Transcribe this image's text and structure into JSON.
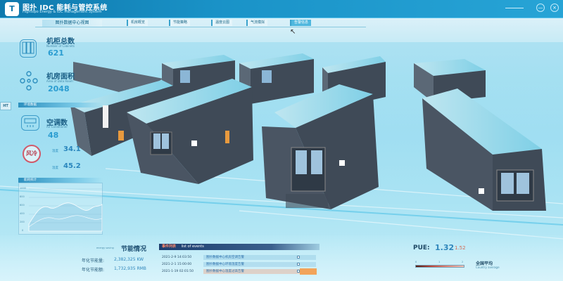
{
  "header": {
    "logo_glyph": "T",
    "title": "图扑 IDC 能耗与管控系统",
    "subtitle": "Hightopo Energy & IDC Management System",
    "controls": [
      "—",
      "×"
    ]
  },
  "nav": {
    "active_label": "图扑数据中心视图",
    "tabs": [
      {
        "label": "机房概览",
        "selected": false
      },
      {
        "label": "节能策略",
        "selected": false
      },
      {
        "label": "温度云图",
        "selected": false
      },
      {
        "label": "气流模拟",
        "selected": false
      },
      {
        "label": "告警信息",
        "selected": true
      }
    ]
  },
  "kpis": {
    "cabinets": {
      "label": "机柜总数",
      "sub": "Number of Cabinets",
      "value": "621",
      "icon": "cabinet-icon"
    },
    "area": {
      "label": "机房面积",
      "sub": "Area of Data Room",
      "value": "2048",
      "icon": "area-icon"
    }
  },
  "env": {
    "bar_label": "环境数据",
    "ht_label": "HT",
    "ac": {
      "label": "空调数",
      "sub": "Air Conditioner",
      "value": "48",
      "icon": "air-conditioner-icon"
    },
    "wind": {
      "label": "风冷",
      "temp1_label": "温度",
      "temp1_value": "34.1",
      "temp2_label": "温度",
      "temp2_value": "45.2"
    }
  },
  "energy_chart": {
    "bar_label": "能耗统计",
    "ticks": [
      "1000",
      "800",
      "600",
      "400",
      "200",
      "0"
    ]
  },
  "energy": {
    "title": "节能情况",
    "sub": "energy saving",
    "rows": [
      {
        "label": "年化节能量:",
        "value": "2,382,325 KW"
      },
      {
        "label": "年化节能额:",
        "value": "1,732,935 RMB"
      }
    ]
  },
  "events": {
    "title": "事件列表",
    "sub": "list of events",
    "rows": [
      {
        "time": "2021-2-9 14:03:50",
        "text": "图扑数据中心机房空调告警",
        "checked": false
      },
      {
        "time": "2021-2-1 15:00:00",
        "text": "图扑数据中心环境湿度告警",
        "checked": false
      },
      {
        "time": "2021-1-19 02:01:50",
        "text": "图扑数据中心温度过高告警",
        "checked": false
      }
    ]
  },
  "pue": {
    "label": "PUE:",
    "value": "1.32",
    "value2": "1.52",
    "avg_label": "全国平均",
    "avg_sub": "Country average",
    "ticks": [
      "0",
      "1",
      "2"
    ]
  },
  "colors": {
    "header": "#0f79ad",
    "accent": "#2b9dd1",
    "alert": "#d36a55",
    "event_tag": "#f2a45a"
  }
}
